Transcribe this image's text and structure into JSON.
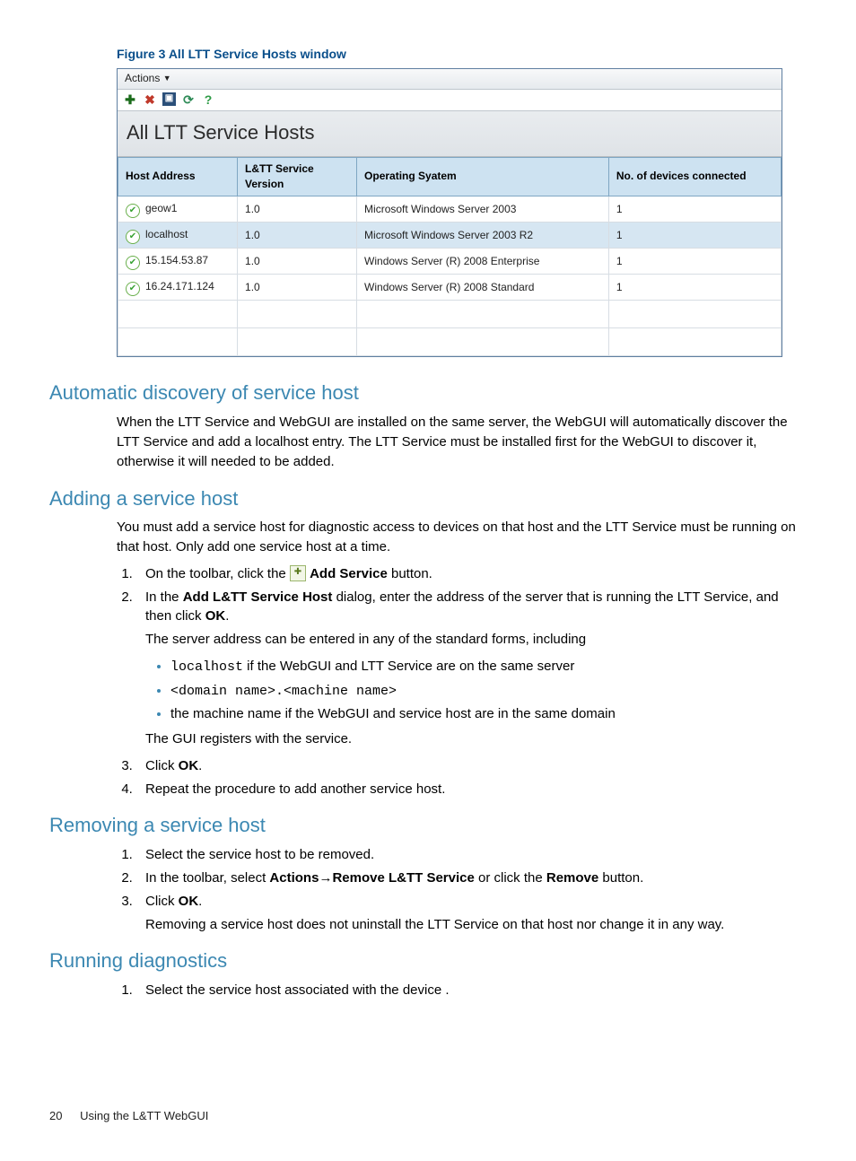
{
  "figure_caption": "Figure 3 All LTT Service Hosts window",
  "screenshot": {
    "menu_actions": "Actions",
    "section_title": "All LTT Service Hosts",
    "icons": {
      "add": "add-service-icon",
      "delete": "delete-icon",
      "view": "view-icon",
      "refresh": "refresh-icon",
      "help": "help-icon"
    },
    "columns": {
      "host": "Host Address",
      "version": "L&TT Service Version",
      "os": "Operating Syatem",
      "devices": "No. of devices connected"
    },
    "rows": [
      {
        "host": "geow1",
        "version": "1.0",
        "os": "Microsoft Windows Server 2003",
        "devices": "1",
        "selected": false
      },
      {
        "host": "localhost",
        "version": "1.0",
        "os": "Microsoft Windows Server 2003 R2",
        "devices": "1",
        "selected": true
      },
      {
        "host": "15.154.53.87",
        "version": "1.0",
        "os": "Windows Server (R) 2008 Enterprise",
        "devices": "1",
        "selected": false
      },
      {
        "host": "16.24.171.124",
        "version": "1.0",
        "os": "Windows Server (R) 2008 Standard",
        "devices": "1",
        "selected": false
      }
    ]
  },
  "h_auto": "Automatic discovery of service host",
  "p_auto": "When the LTT Service and WebGUI are installed on the same server, the WebGUI will automatically discover the LTT Service and add a localhost entry. The LTT Service must be installed first for the WebGUI to discover it, otherwise it will needed to be added.",
  "h_add": "Adding a service host",
  "p_add": "You must add a service host for diagnostic access to devices on that host and the LTT Service must be running on that host. Only add one service host at a time.",
  "steps_add": {
    "s1_pre": "On the toolbar, click the ",
    "s1_bold": "Add Service",
    "s1_post": " button.",
    "s2_pre": "In the ",
    "s2_bold": "Add L&TT Service Host",
    "s2_mid": " dialog, enter the address of the server that is running the LTT Service, and then click ",
    "s2_ok": "OK",
    "s2_post": ".",
    "s2_note": "The server address can be entered in any of the standard forms, including",
    "b1_code": "localhost",
    "b1_rest": " if the WebGUI and LTT Service are on the same server",
    "b2": "<domain name>.<machine name>",
    "b3": "the machine name if the WebGUI and service host are in the same domain",
    "s2_gui": "The GUI registers with the service.",
    "s3_pre": "Click ",
    "s3_bold": "OK",
    "s3_post": ".",
    "s4": "Repeat the procedure to add another service host."
  },
  "h_remove": "Removing a service host",
  "steps_remove": {
    "r1": "Select the service host to be removed.",
    "r2_pre": "In the toolbar, select ",
    "r2_a": "Actions",
    "r2_arrow": "→",
    "r2_b": "Remove L&TT Service",
    "r2_mid": " or click the ",
    "r2_c": "Remove",
    "r2_post": " button.",
    "r3_pre": "Click ",
    "r3_bold": "OK",
    "r3_post": ".",
    "r3_note": "Removing a service host does not uninstall the LTT Service on that host nor change it in any way."
  },
  "h_diag": "Running diagnostics",
  "steps_diag": {
    "d1": "Select the service host associated with the device ."
  },
  "footer": {
    "page": "20",
    "title": "Using the L&TT WebGUI"
  }
}
